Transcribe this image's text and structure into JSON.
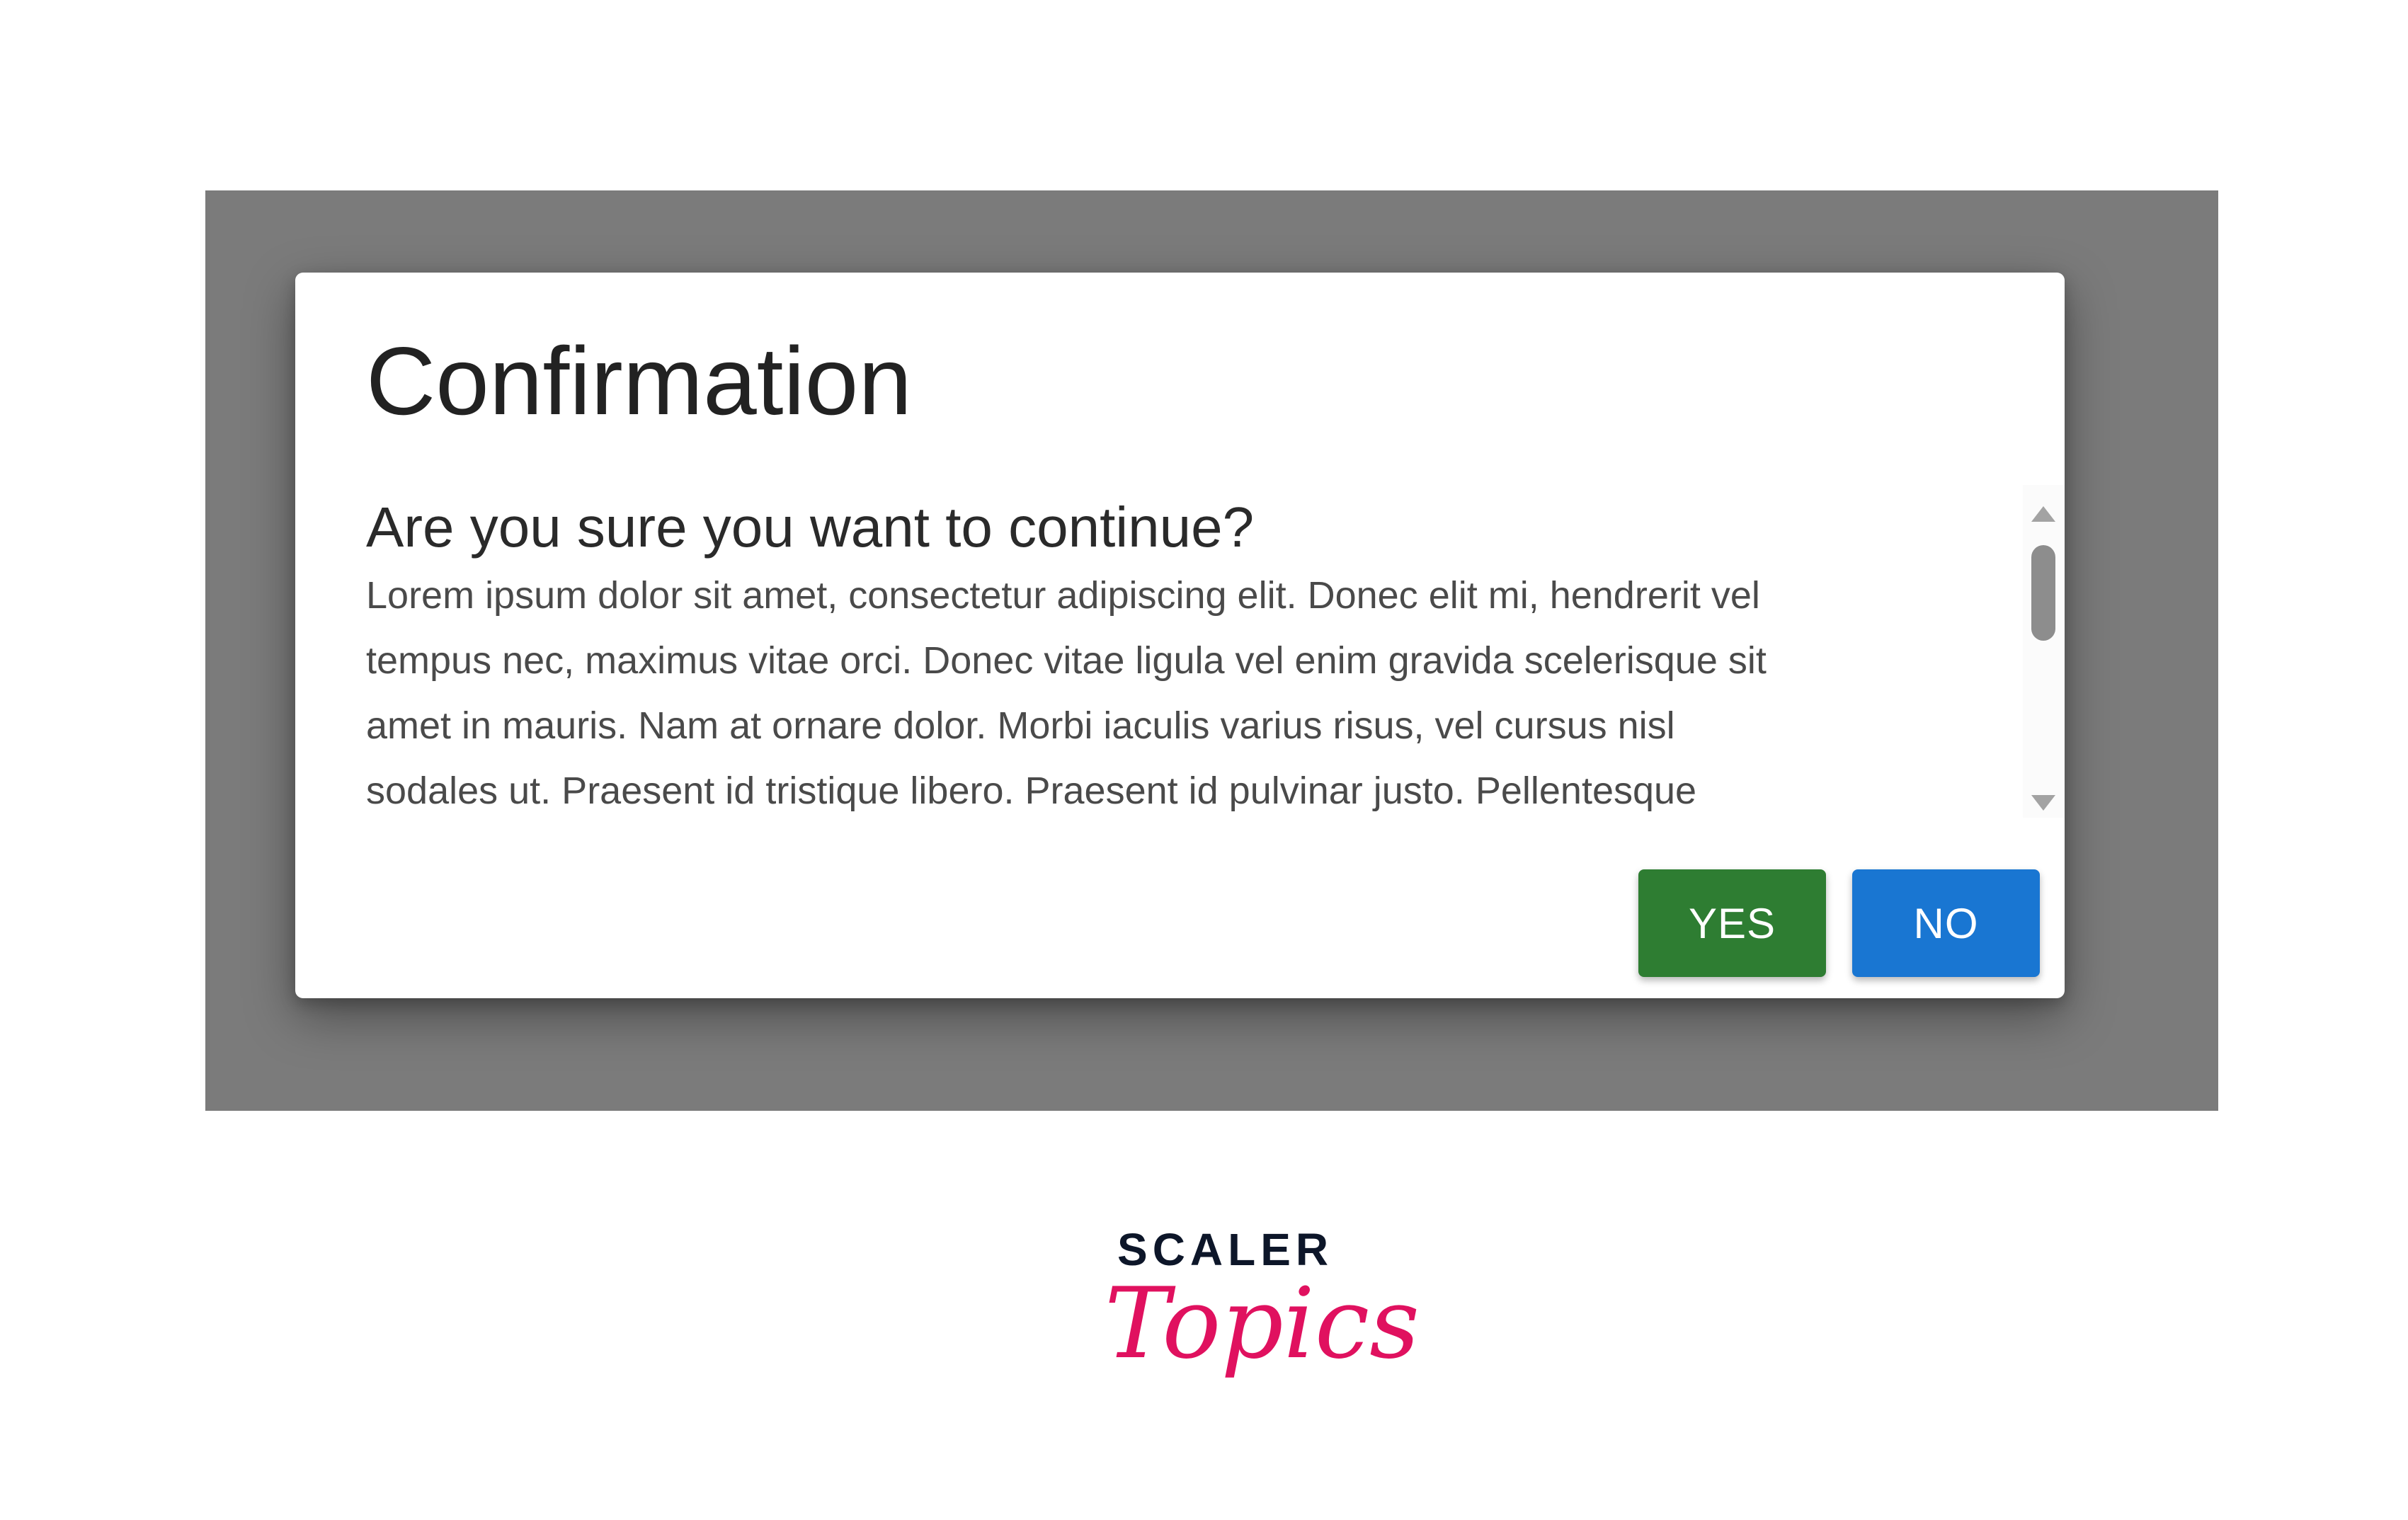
{
  "dialog": {
    "title": "Confirmation",
    "subtitle": "Are you sure you want to continue?",
    "body_lines": [
      "Lorem ipsum dolor sit amet, consectetur adipiscing elit. Donec elit mi, hendrerit vel",
      "tempus nec, maximus vitae orci. Donec vitae ligula vel enim gravida scelerisque sit",
      "amet in mauris. Nam at ornare dolor. Morbi iaculis varius risus, vel cursus nisl",
      "sodales ut. Praesent id tristique libero. Praesent id pulvinar justo. Pellentesque"
    ],
    "buttons": {
      "yes_label": "YES",
      "no_label": "NO"
    }
  },
  "scrollbar": {
    "up_icon": "arrow-up-icon",
    "down_icon": "arrow-down-icon"
  },
  "logo": {
    "line1": "SCALER",
    "line2": "Topics"
  },
  "colors": {
    "overlay": "#7b7b7b",
    "yes_button": "#2e7d32",
    "no_button": "#1976d2",
    "logo_dark": "#0d1629",
    "logo_accent": "#e0115f"
  }
}
